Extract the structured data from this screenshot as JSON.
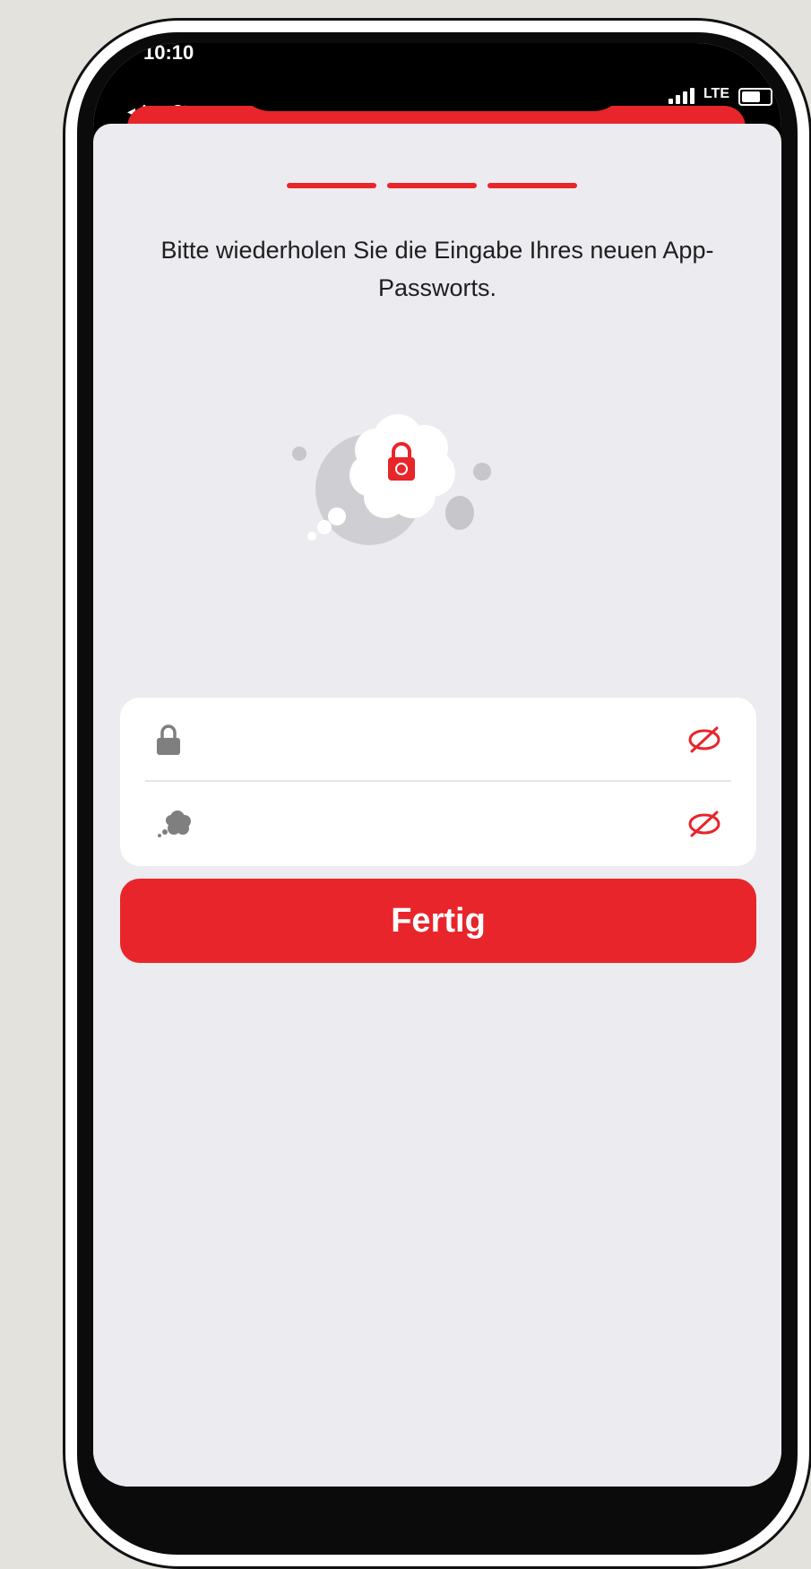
{
  "status_bar": {
    "time": "10:10",
    "back_label": "◂ App Store",
    "network": "LTE"
  },
  "progress": {
    "steps": 3,
    "current": 3
  },
  "prompt": {
    "text": "Bitte wiederholen Sie die Eingabe Ihres neuen App-Passworts."
  },
  "fields": [
    {
      "icon": "lock-icon",
      "value": "",
      "placeholder": "",
      "visibility_icon": "eye-slash-icon"
    },
    {
      "icon": "thought-cloud-icon",
      "value": "",
      "placeholder": "",
      "visibility_icon": "eye-slash-icon"
    }
  ],
  "button": {
    "label": "Fertig"
  },
  "colors": {
    "accent": "#e8252a",
    "background": "#ebebf0",
    "card": "#ffffff",
    "icon_gray": "#7f7f7f"
  }
}
